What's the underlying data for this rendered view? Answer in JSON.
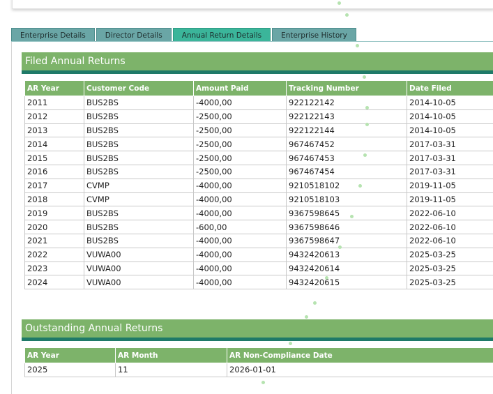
{
  "tabs": [
    {
      "label": "Enterprise Details",
      "active": false
    },
    {
      "label": "Director Details",
      "active": false
    },
    {
      "label": "Annual Return Details",
      "active": true
    },
    {
      "label": "Enterprise History",
      "active": false
    }
  ],
  "filed": {
    "title": "Filed Annual Returns",
    "headers": [
      "AR Year",
      "Customer Code",
      "Amount Paid",
      "Tracking Number",
      "Date Filed"
    ],
    "rows": [
      [
        "2011",
        "BUS2BS",
        "-4000,00",
        "922122142",
        "2014-10-05"
      ],
      [
        "2012",
        "BUS2BS",
        "-2500,00",
        "922122143",
        "2014-10-05"
      ],
      [
        "2013",
        "BUS2BS",
        "-2500,00",
        "922122144",
        "2014-10-05"
      ],
      [
        "2014",
        "BUS2BS",
        "-2500,00",
        "967467452",
        "2017-03-31"
      ],
      [
        "2015",
        "BUS2BS",
        "-2500,00",
        "967467453",
        "2017-03-31"
      ],
      [
        "2016",
        "BUS2BS",
        "-2500,00",
        "967467454",
        "2017-03-31"
      ],
      [
        "2017",
        "CVMP",
        "-4000,00",
        "9210518102",
        "2019-11-05"
      ],
      [
        "2018",
        "CVMP",
        "-4000,00",
        "9210518103",
        "2019-11-05"
      ],
      [
        "2019",
        "BUS2BS",
        "-4000,00",
        "9367598645",
        "2022-06-10"
      ],
      [
        "2020",
        "BUS2BS",
        "-600,00",
        "9367598646",
        "2022-06-10"
      ],
      [
        "2021",
        "BUS2BS",
        "-4000,00",
        "9367598647",
        "2022-06-10"
      ],
      [
        "2022",
        "VUWA00",
        "-4000,00",
        "9432420613",
        "2025-03-25"
      ],
      [
        "2023",
        "VUWA00",
        "-4000,00",
        "9432420614",
        "2025-03-25"
      ],
      [
        "2024",
        "VUWA00",
        "-4000,00",
        "9432420615",
        "2025-03-25"
      ]
    ]
  },
  "outstanding": {
    "title": "Outstanding Annual Returns",
    "headers": [
      "AR Year",
      "AR Month",
      "AR Non-Compliance Date"
    ],
    "rows": [
      [
        "2025",
        "11",
        "2026-01-01"
      ]
    ]
  }
}
